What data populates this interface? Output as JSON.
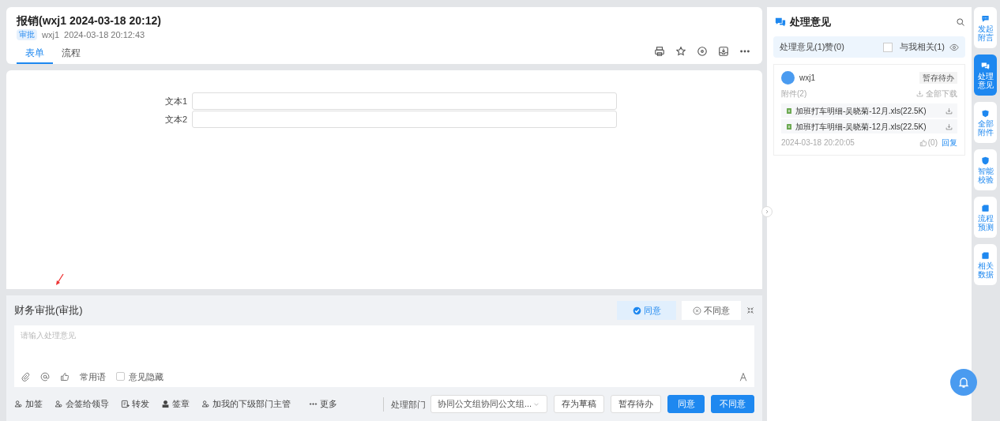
{
  "header": {
    "title": "报销(wxj1 2024-03-18 20:12)",
    "tag": "审批",
    "user": "wxj1",
    "time": "2024-03-18 20:12:43",
    "tabs": [
      {
        "label": "表单",
        "selected": true
      },
      {
        "label": "流程",
        "selected": false
      }
    ]
  },
  "form": {
    "fields": [
      {
        "label": "文本1"
      },
      {
        "label": "文本2"
      }
    ]
  },
  "approval": {
    "title": "财务审批(审批)",
    "decisions": [
      {
        "label": "同意",
        "selected": true,
        "kind": "agree"
      },
      {
        "label": "不同意",
        "selected": false,
        "kind": "disagree"
      }
    ],
    "placeholder": "请输入处理意见",
    "phrases": "常用语",
    "hide_opinion": {
      "label": "意见隐藏",
      "checked": false
    },
    "actions": [
      {
        "label": "加签",
        "kind": "people"
      },
      {
        "label": "会签给领导",
        "kind": "people"
      },
      {
        "label": "转发",
        "kind": "forward"
      },
      {
        "label": "签章",
        "kind": "stamp"
      },
      {
        "label": "加我的下级部门主管",
        "kind": "people"
      },
      {
        "label": "更多",
        "kind": "more"
      }
    ],
    "dept_label": "处理部门",
    "dept_value": "协同公文组协同公文组...",
    "buttons": [
      {
        "label": "存为草稿",
        "kind": "default"
      },
      {
        "label": "暂存待办",
        "kind": "default"
      },
      {
        "label": "同意",
        "kind": "primary"
      },
      {
        "label": "不同意",
        "kind": "primary"
      }
    ]
  },
  "opinions": {
    "title": "处理意见",
    "summary": "处理意见(1)赞(0)",
    "related": {
      "label": "与我相关(1)",
      "checked": false
    },
    "comment": {
      "user": "wxj1",
      "status": "暂存待办",
      "attachments_label": "附件(2)",
      "download_all": "全部下载",
      "files": [
        "加班打车明细-吴晓菊-12月.xls(22.5K)",
        "加班打车明细-吴晓菊-12月.xls(22.5K)"
      ],
      "time": "2024-03-18 20:20:05",
      "likes": "(0)",
      "reply": "回复"
    }
  },
  "rail": [
    {
      "label": "发起附言",
      "selected": false
    },
    {
      "label": "处理意见",
      "selected": true
    },
    {
      "label": "全部附件",
      "selected": false
    },
    {
      "label": "智能校验",
      "selected": false
    },
    {
      "label": "流程预测",
      "selected": false
    },
    {
      "label": "相关数据",
      "selected": false
    }
  ]
}
